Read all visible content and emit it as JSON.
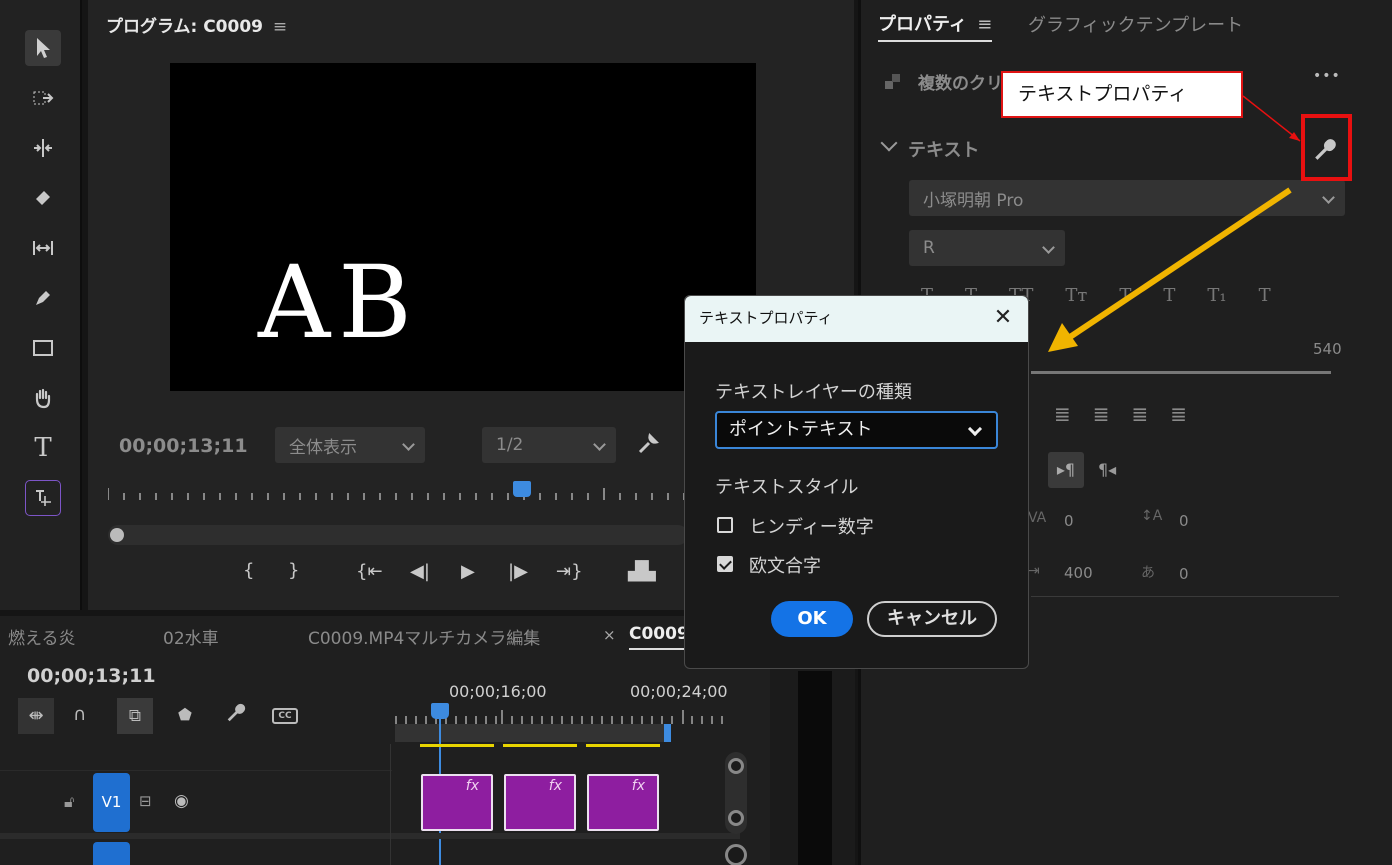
{
  "toolbar": {
    "tools": [
      "selection-tool",
      "track-select-tool",
      "ripple-edit-tool",
      "razor-tool",
      "slip-tool",
      "pen-tool",
      "rectangle-tool",
      "hand-tool",
      "type-tool",
      "essential-graphics-tool"
    ]
  },
  "program_monitor": {
    "title": "プログラム: C0009",
    "menu_icon": "≡",
    "preview_text": "AB",
    "timecode": "00;00;13;11",
    "fit_dropdown": "全体表示",
    "resolution_dropdown": "1/2"
  },
  "properties_panel": {
    "tab_active": "プロパティ",
    "tab_menu": "≡",
    "tab_other": "グラフィックテンプレート",
    "header_text": "複数のクリ",
    "more_icon": "•••",
    "section_title": "テキスト",
    "font_family": "小塚明朝 Pro",
    "font_style": "R",
    "style_buttons": [
      "T",
      "T",
      "TT",
      "Tт",
      "T",
      "T",
      "T₁",
      "T"
    ],
    "size_value": "540",
    "values": {
      "tracking": "0",
      "baseline": "0",
      "leading": "400",
      "tsume": "0"
    }
  },
  "timeline": {
    "tabs": [
      "燃える炎",
      "02水車",
      "C0009.MP4マルチカメラ編集",
      "C0009"
    ],
    "close_mark": "×",
    "timecode": "00;00;13;11",
    "ruler_times": [
      "00;00;16;00",
      "00;00;24;00"
    ],
    "track_label": "V1",
    "clip_fx": "fx"
  },
  "dialog": {
    "title": "テキストプロパティ",
    "close_glyph": "✕",
    "layer_type_label": "テキストレイヤーの種類",
    "layer_type_value": "ポイントテキスト",
    "text_style_label": "テキストスタイル",
    "checkbox1_label": "ヒンディー数字",
    "checkbox1_checked": false,
    "checkbox2_label": "欧文合字",
    "checkbox2_checked": true,
    "ok_label": "OK",
    "cancel_label": "キャンセル"
  },
  "annotation": {
    "callout_text": "テキストプロパティ",
    "highlight_color": "#e81010",
    "arrow_color": "#f0b400"
  }
}
